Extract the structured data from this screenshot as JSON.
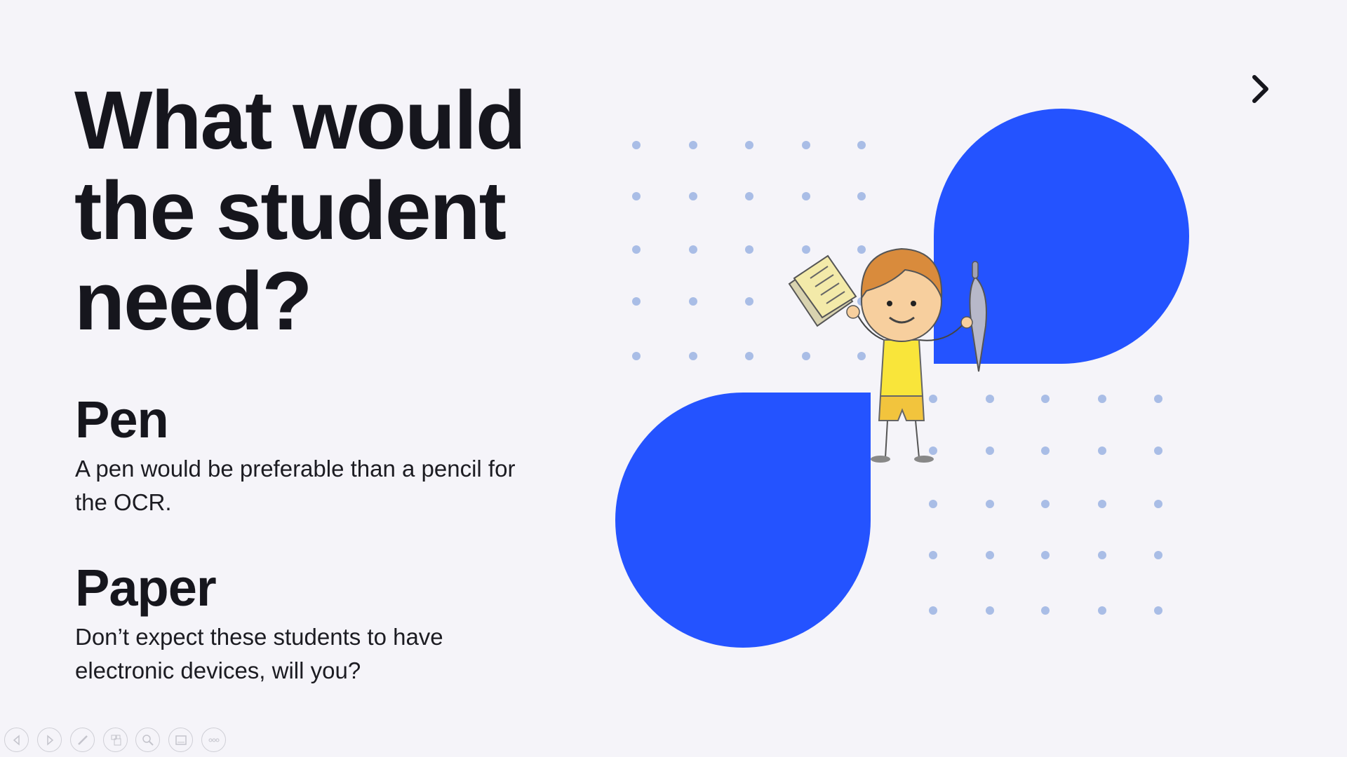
{
  "slide": {
    "title": "What would the student need?",
    "sections": [
      {
        "heading": "Pen",
        "body": "A pen would be preferable than a pencil for the OCR."
      },
      {
        "heading": "Paper",
        "body": "Don’t expect these students to have electronic devices, will you?"
      }
    ]
  },
  "colors": {
    "accent": "#2453ff",
    "dots": "#a9bde6",
    "background": "#f5f4f9"
  },
  "navigation": {
    "next_icon": "chevron-right-icon"
  },
  "toolbar": {
    "buttons": [
      "previous-slide",
      "next-slide",
      "pen-tool",
      "see-all-slides",
      "zoom",
      "subtitles",
      "more-options"
    ]
  }
}
